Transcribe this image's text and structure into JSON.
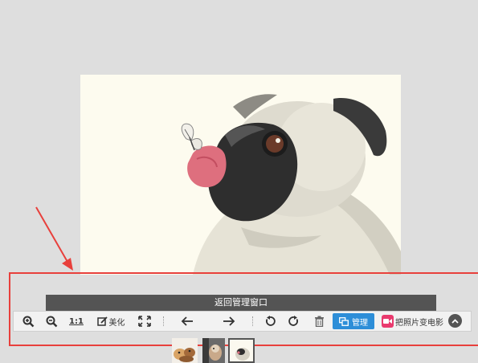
{
  "viewer": {
    "photo_icon": "pug-with-butterfly-image",
    "return_label": "返回管理窗口"
  },
  "toolbar": {
    "zoom_in_icon": "zoom-in-icon",
    "zoom_out_icon": "zoom-out-icon",
    "actual_size_label": "1:1",
    "beautify_label": "美化",
    "fullscreen_icon": "expand-icon",
    "prev_icon": "arrow-left-icon",
    "next_icon": "arrow-right-icon",
    "rotate_left_icon": "rotate-ccw-icon",
    "rotate_right_icon": "rotate-cw-icon",
    "delete_icon": "trash-icon",
    "manage_label": "管理",
    "movie_label": "把照片变电影",
    "collapse_icon": "chevron-up-icon"
  },
  "thumbnails": [
    {
      "icon": "thumbnail-cats"
    },
    {
      "icon": "thumbnail-dog"
    },
    {
      "icon": "thumbnail-pug-selected"
    }
  ],
  "colors": {
    "annotation": "#e8403c",
    "manage_button": "#2d8ed8",
    "movie_icon": "#e93a6e",
    "return_bar": "#545454"
  }
}
